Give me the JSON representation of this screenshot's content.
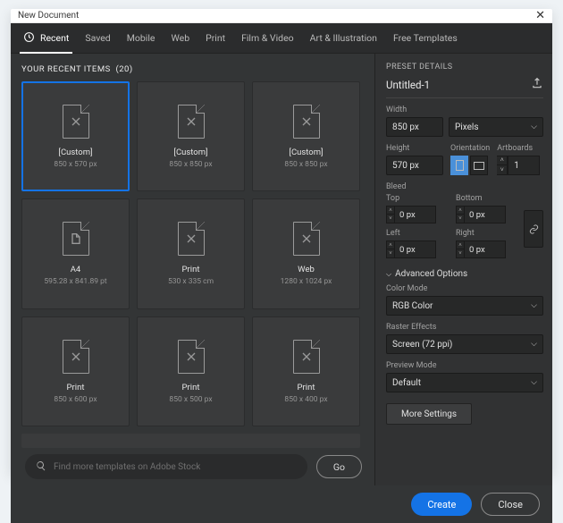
{
  "window": {
    "title": "New Document"
  },
  "tabs": {
    "items": [
      {
        "label": "Recent",
        "active": true,
        "icon": "clock"
      },
      {
        "label": "Saved"
      },
      {
        "label": "Mobile"
      },
      {
        "label": "Web"
      },
      {
        "label": "Print"
      },
      {
        "label": "Film & Video"
      },
      {
        "label": "Art & Illustration"
      },
      {
        "label": "Free Templates"
      }
    ]
  },
  "recent": {
    "heading_prefix": "YOUR RECENT ITEMS",
    "count": "(20)",
    "items": [
      {
        "label": "[Custom]",
        "dims": "850 x 570 px",
        "icon": "custom",
        "selected": true
      },
      {
        "label": "[Custom]",
        "dims": "850 x 850 px",
        "icon": "custom"
      },
      {
        "label": "[Custom]",
        "dims": "850 x 850 px",
        "icon": "custom"
      },
      {
        "label": "A4",
        "dims": "595.28 x 841.89 pt",
        "icon": "a4"
      },
      {
        "label": "Print",
        "dims": "530 x 335 cm",
        "icon": "custom"
      },
      {
        "label": "Web",
        "dims": "1280 x 1024 px",
        "icon": "custom"
      },
      {
        "label": "Print",
        "dims": "850 x 600 px",
        "icon": "print"
      },
      {
        "label": "Print",
        "dims": "850 x 500 px",
        "icon": "print"
      },
      {
        "label": "Print",
        "dims": "850 x 400 px",
        "icon": "print"
      }
    ]
  },
  "search": {
    "placeholder": "Find more templates on Adobe Stock",
    "go_label": "Go"
  },
  "preset": {
    "heading": "PRESET DETAILS",
    "name": "Untitled-1",
    "width_label": "Width",
    "width_value": "850 px",
    "units": "Pixels",
    "height_label": "Height",
    "height_value": "570 px",
    "orientation_label": "Orientation",
    "artboards_label": "Artboards",
    "artboards_value": "1",
    "bleed_label": "Bleed",
    "top_label": "Top",
    "bottom_label": "Bottom",
    "left_label": "Left",
    "right_label": "Right",
    "bleed_value": "0 px",
    "advanced_label": "Advanced Options",
    "color_mode_label": "Color Mode",
    "color_mode_value": "RGB Color",
    "raster_label": "Raster Effects",
    "raster_value": "Screen (72 ppi)",
    "preview_label": "Preview Mode",
    "preview_value": "Default",
    "more_settings": "More Settings"
  },
  "footer": {
    "create": "Create",
    "close": "Close"
  }
}
